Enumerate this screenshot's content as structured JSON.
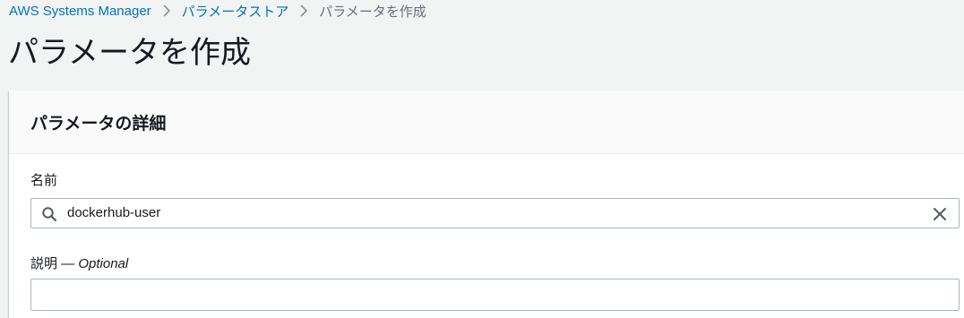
{
  "breadcrumb": {
    "items": [
      {
        "label": "AWS Systems Manager"
      },
      {
        "label": "パラメータストア"
      },
      {
        "label": "パラメータを作成"
      }
    ],
    "separator_icon": "chevron-right-icon"
  },
  "page": {
    "title": "パラメータを作成"
  },
  "panel": {
    "title": "パラメータの詳細",
    "name_field": {
      "label": "名前",
      "value": "dockerhub-user",
      "leading_icon": "search-icon",
      "trailing_icon": "clear-icon"
    },
    "description_field": {
      "label": "説明",
      "optional_text": "— Optional",
      "value": ""
    }
  },
  "colors": {
    "link": "#0073bb",
    "muted": "#687078",
    "text": "#16191f",
    "background": "#f2f3f3",
    "input_border": "#aab7b8"
  }
}
